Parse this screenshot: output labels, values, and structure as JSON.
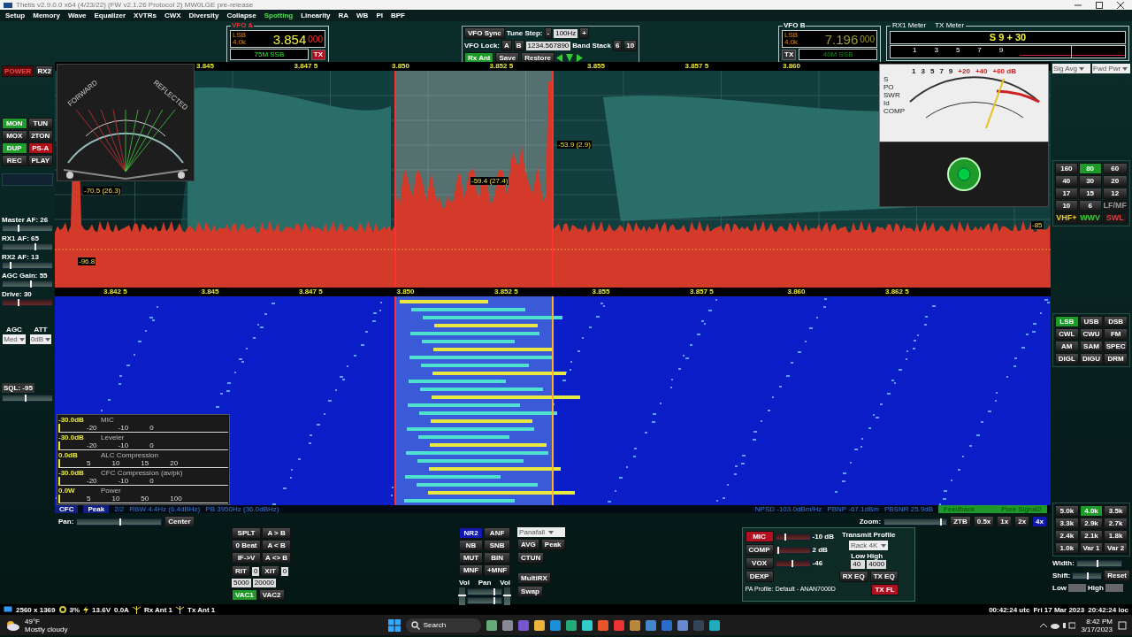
{
  "window": {
    "title": "Thetis v2.9.0.0 x64 (4/23/22) (FW v2.1.26 Protocol 2) MW0LGE pre-release"
  },
  "menu": [
    {
      "label": "Setup",
      "selected": false
    },
    {
      "label": "Memory",
      "selected": false
    },
    {
      "label": "Wave",
      "selected": false
    },
    {
      "label": "Equalizer",
      "selected": false
    },
    {
      "label": "XVTRs",
      "selected": false
    },
    {
      "label": "CWX",
      "selected": false
    },
    {
      "label": "Diversity",
      "selected": false
    },
    {
      "label": "Collapse",
      "selected": false
    },
    {
      "label": "Spotting",
      "selected": true
    },
    {
      "label": "Linearity",
      "selected": false
    },
    {
      "label": "RA",
      "selected": false
    },
    {
      "label": "WB",
      "selected": false
    },
    {
      "label": "PI",
      "selected": false
    },
    {
      "label": "BPF",
      "selected": false
    }
  ],
  "vfo_a": {
    "legend": "VFO A",
    "mode": "LSB",
    "filter": "4.0k",
    "freq": "3.854",
    "freq_sub": "000",
    "band": "75M SSB",
    "tx": "TX",
    "tx_on": true
  },
  "vfo_sync": {
    "sync": "VFO Sync",
    "lock_label": "VFO Lock:",
    "lock_a": "A",
    "lock_b": "B",
    "tune_step_label": "Tune Step:",
    "minus": "-",
    "step": "100Hz",
    "plus": "+",
    "freq_field": "1234.567890",
    "band_stack_label": "Band Stack",
    "stack_a": "6",
    "stack_b": "10",
    "rx_ant": "Rx Ant",
    "save": "Save",
    "restore": "Restore"
  },
  "vfo_b": {
    "legend": "VFO B",
    "mode": "LSB",
    "filter": "4.0k",
    "freq": "7.196",
    "freq_sub": "000",
    "band": "40M SSB",
    "tx": "TX",
    "tx_on": false
  },
  "meter": {
    "rx_label": "RX1 Meter",
    "tx_label": "TX Meter",
    "reading": "S 9 + 30",
    "ticks": [
      "1",
      "3",
      "5",
      "7",
      "9"
    ],
    "level": 0.77
  },
  "left": {
    "power": {
      "label": "POWER",
      "on": true
    },
    "rx2": "RX2",
    "toggles": [
      {
        "label": "MON",
        "on": true,
        "color": "#1e9e2a"
      },
      {
        "label": "TUN",
        "on": false
      },
      {
        "label": "MOX",
        "on": false
      },
      {
        "label": "2TON",
        "on": false
      },
      {
        "label": "DUP",
        "on": true,
        "color": "#1e9e2a"
      },
      {
        "label": "PS-A",
        "on": true,
        "color": "#b0101a"
      },
      {
        "label": "REC",
        "on": false
      },
      {
        "label": "PLAY",
        "on": false
      }
    ],
    "sliders": [
      {
        "label": "Master AF: 26",
        "level": 0.3
      },
      {
        "label": "RX1 AF: 65",
        "level": 0.65
      },
      {
        "label": "RX2 AF: 13",
        "level": 0.15
      },
      {
        "label": "AGC Gain: 55",
        "level": 0.55
      },
      {
        "label": "Drive: 30",
        "level": 0.3
      }
    ],
    "agc": {
      "label": "AGC",
      "value": "Med"
    },
    "att": {
      "label": "ATT",
      "value": "0dB"
    },
    "sql": {
      "label": "SQL: -95",
      "level": 0.45
    }
  },
  "swr_meter": {
    "forward": "FORWARD",
    "reflected": "REFLECTED"
  },
  "spectrum": {
    "axis": [
      "3.845",
      "3.847 5",
      "3.850",
      "3.852 5",
      "3.855",
      "3.857 5",
      "3.860"
    ],
    "markers": [
      "-70.5 (26.3)",
      "-59.4 (27.4)",
      "-53.9 (2.9)"
    ],
    "floor": "-96.8",
    "edge": "-85"
  },
  "analog_meter": {
    "scale": [
      "1",
      "3",
      "5",
      "7",
      "9",
      "+20",
      "+40",
      "+60 dB"
    ],
    "labels": [
      "S",
      "PO",
      "SWR",
      "Id",
      "COMP"
    ]
  },
  "waterfall": {
    "axis": [
      "3.842 5",
      "3.845",
      "3.847 5",
      "3.850",
      "3.852 5",
      "3.855",
      "3.857 5",
      "3.860",
      "3.862 5"
    ]
  },
  "tx_meters": [
    {
      "title": "MIC",
      "reading": "-30.0dB",
      "ticks": [
        "-20",
        "-10",
        "0"
      ]
    },
    {
      "title": "Leveler",
      "reading": "-30.0dB",
      "ticks": [
        "-20",
        "-10",
        "0"
      ]
    },
    {
      "title": "ALC Compression",
      "reading": "0.0dB",
      "ticks": [
        "5",
        "10",
        "15",
        "20"
      ]
    },
    {
      "title": "CFC Compression (av/pk)",
      "reading": "-30.0dB",
      "ticks": [
        "-20",
        "-10",
        "0"
      ]
    },
    {
      "title": "Power",
      "reading": "0.0W",
      "ticks": [
        "5",
        "10",
        "50",
        "100"
      ]
    }
  ],
  "info_line": {
    "cfc": "CFC",
    "peak": "Peak",
    "count": "2/2",
    "rbw": "RBW 4.4Hz (6.4dBHz)",
    "pb": "PB 3950Hz (36.0dBHz)",
    "npsd": "NPSD -103.0dBm/Hz",
    "pbnp": "PBNP -67.1dBm",
    "pbsnr": "PBSNR 25.9dB",
    "feedback": "Feedback",
    "pure_signal": "Pure Signal2"
  },
  "right": {
    "displays": [
      "Sig Avg",
      "Fwd Pwr"
    ],
    "bands": [
      {
        "label": "160",
        "selected": false
      },
      {
        "label": "80",
        "selected": true
      },
      {
        "label": "60",
        "selected": false
      },
      {
        "label": "40",
        "selected": false
      },
      {
        "label": "30",
        "selected": false
      },
      {
        "label": "20",
        "selected": false
      },
      {
        "label": "17",
        "selected": false
      },
      {
        "label": "15",
        "selected": false
      },
      {
        "label": "12",
        "selected": false
      },
      {
        "label": "10",
        "selected": false
      },
      {
        "label": "6",
        "selected": false
      },
      {
        "label": "LF/MF",
        "selected": false,
        "color": "#9a9a9a"
      },
      {
        "label": "VHF+",
        "selected": false,
        "color": "#e8d020"
      },
      {
        "label": "WWV",
        "selected": false,
        "color": "#3cc83c"
      },
      {
        "label": "SWL",
        "selected": false,
        "color": "#e03c3c"
      }
    ],
    "modes": [
      {
        "label": "LSB",
        "selected": true
      },
      {
        "label": "USB",
        "selected": false
      },
      {
        "label": "DSB",
        "selected": false
      },
      {
        "label": "CWL",
        "selected": false
      },
      {
        "label": "CWU",
        "selected": false
      },
      {
        "label": "FM",
        "selected": false
      },
      {
        "label": "AM",
        "selected": false
      },
      {
        "label": "SAM",
        "selected": false
      },
      {
        "label": "SPEC",
        "selected": false
      },
      {
        "label": "DIGL",
        "selected": false
      },
      {
        "label": "DIGU",
        "selected": false
      },
      {
        "label": "DRM",
        "selected": false
      }
    ],
    "filters": [
      {
        "label": "5.0k",
        "selected": false
      },
      {
        "label": "4.0k",
        "selected": true
      },
      {
        "label": "3.5k",
        "selected": false
      },
      {
        "label": "3.3k",
        "selected": false
      },
      {
        "label": "2.9k",
        "selected": false
      },
      {
        "label": "2.7k",
        "selected": false
      },
      {
        "label": "2.4k",
        "selected": false
      },
      {
        "label": "2.1k",
        "selected": false
      },
      {
        "label": "1.8k",
        "selected": false
      },
      {
        "label": "1.0k",
        "selected": false
      },
      {
        "label": "Var 1",
        "selected": false
      },
      {
        "label": "Var 2",
        "selected": false
      }
    ],
    "width": {
      "label": "Width:",
      "level": 0.45
    },
    "shift": {
      "label": "Shift:",
      "level": 0.5,
      "reset": "Reset"
    },
    "low_label": "Low",
    "high_label": "High"
  },
  "bottom": {
    "pan": {
      "label": "Pan:",
      "level": 0.5,
      "center": "Center"
    },
    "vfo_buttons": [
      "SPLT",
      "A > B",
      "0 Beat",
      "A < B",
      "IF->V",
      "A <> B"
    ],
    "rit": {
      "label": "RIT",
      "value": "0"
    },
    "xit": {
      "label": "XIT",
      "value": "0"
    },
    "rit_step": "5000",
    "xit_step": "20000",
    "vac": [
      {
        "label": "VAC1",
        "on": true
      },
      {
        "label": "VAC2",
        "on": false
      }
    ],
    "dsp": [
      {
        "label": "NR2",
        "selected": true
      },
      {
        "label": "ANF",
        "selected": false
      },
      {
        "label": "NB",
        "selected": false
      },
      {
        "label": "SNB",
        "selected": false
      },
      {
        "label": "MUT",
        "selected": false
      },
      {
        "label": "BIN",
        "selected": false
      },
      {
        "label": "MNF",
        "selected": false
      },
      {
        "label": "+MNF",
        "selected": false
      }
    ],
    "display_mode": "Panafall",
    "avg": "AVG",
    "peak": "Peak",
    "ctun": "CTUN",
    "mix": {
      "vol1": {
        "label": "Vol",
        "level": 0.5
      },
      "pan": "Pan",
      "pan_sliders": [
        {
          "level": 0.75
        },
        {
          "level": 0.75
        }
      ],
      "vol2": {
        "label": "Vol",
        "level": 0.5
      },
      "multirx": "MultiRX",
      "swap": "Swap"
    },
    "zoom": {
      "label": "Zoom:",
      "level": 0.9,
      "buttons": [
        {
          "label": "ZTB",
          "selected": false
        },
        {
          "label": "0.5x",
          "selected": false
        },
        {
          "label": "1x",
          "selected": false
        },
        {
          "label": "2x",
          "selected": false
        },
        {
          "label": "4x",
          "selected": true
        }
      ]
    },
    "transmit": {
      "rows": [
        {
          "label": "MIC",
          "on": true,
          "level": 0.25,
          "reading": "-10 dB"
        },
        {
          "label": "COMP",
          "on": false,
          "level": 0.05,
          "reading": "2 dB"
        },
        {
          "label": "VOX",
          "on": false,
          "level": 0.45,
          "reading": "-46"
        }
      ],
      "dexp": "DEXP",
      "profile_label": "Transmit Profile",
      "profile": "Rack 4K",
      "low_label": "Low",
      "low": "40",
      "high_label": "High",
      "high": "4000",
      "rx_eq": "RX EQ",
      "tx_eq": "TX EQ",
      "tx_fl": "TX FL",
      "pa_profile": "PA Profile: Default - ANAN7000D"
    }
  },
  "status_bar": {
    "resolution": "2560 x 1369",
    "cpu": "3%",
    "volts": "13.6V",
    "amps": "0.0A",
    "rx_ant": "Rx Ant 1",
    "tx_ant": "Tx Ant 1",
    "utc": "00:42:24 utc",
    "date": "Fri 17 Mar 2023",
    "local": "20:42:24 loc"
  },
  "taskbar": {
    "temp": "49°F",
    "weather": "Mostly cloudy",
    "search": "Search",
    "time": "8:42 PM",
    "date": "3/17/2023"
  }
}
